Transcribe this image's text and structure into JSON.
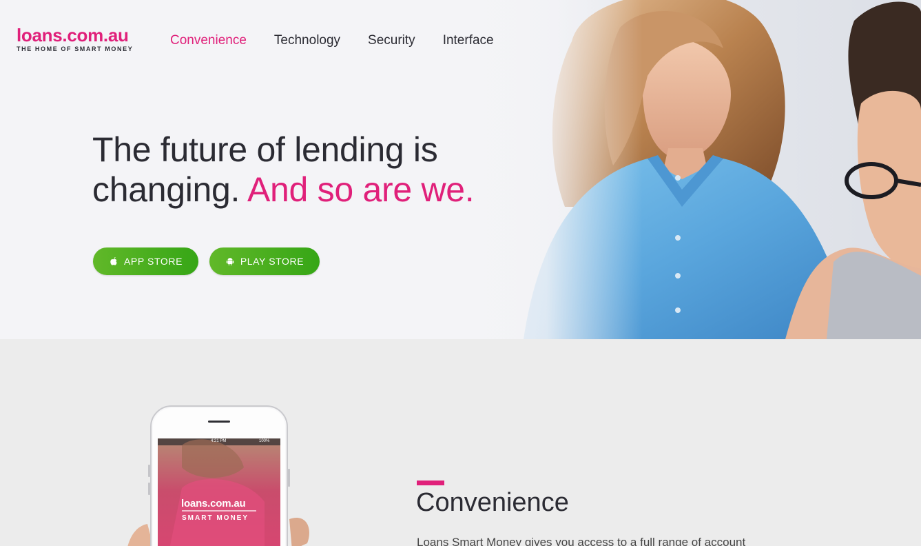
{
  "brand": {
    "name": "loans.com.au",
    "tagline": "THE HOME OF SMART MONEY",
    "accent_color": "#e0207a",
    "button_color": "#4caf20"
  },
  "nav": {
    "items": [
      {
        "label": "Convenience",
        "active": true
      },
      {
        "label": "Technology",
        "active": false
      },
      {
        "label": "Security",
        "active": false
      },
      {
        "label": "Interface",
        "active": false
      }
    ]
  },
  "hero": {
    "headline_line1": "The future of lending is",
    "headline_line2_plain": "changing.",
    "headline_line2_accent": "And so are we.",
    "buttons": {
      "app_store": {
        "label": "APP STORE",
        "icon": "apple-icon"
      },
      "play_store": {
        "label": "PLAY STORE",
        "icon": "android-icon"
      }
    }
  },
  "phone_screen": {
    "status_time": "4:21 PM",
    "status_battery": "100%",
    "brand": "loans.com.au",
    "tagline": "SMART MONEY"
  },
  "section": {
    "title": "Convenience",
    "body": "Loans Smart Money gives you access to a full range of account"
  }
}
